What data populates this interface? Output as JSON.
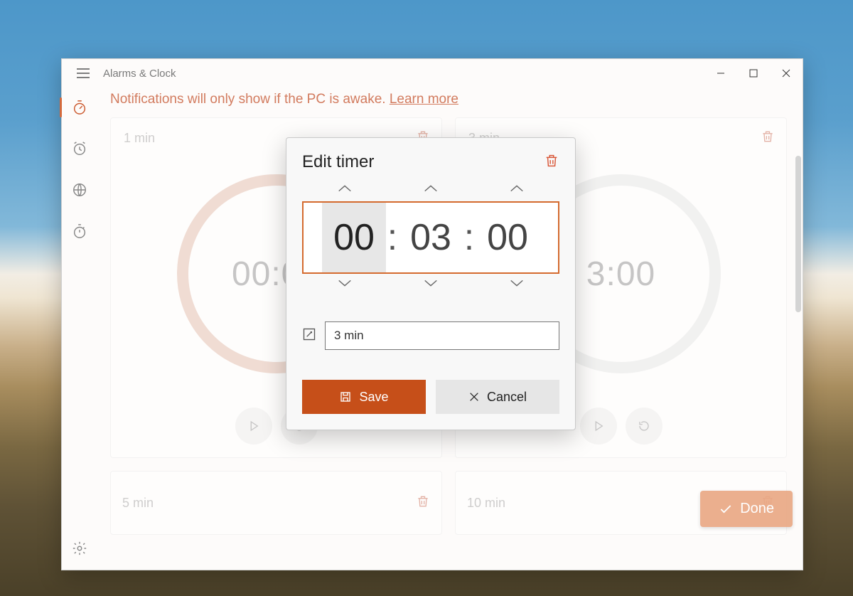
{
  "app": {
    "title": "Alarms & Clock"
  },
  "notice": {
    "text": "Notifications will only show if the PC is awake. ",
    "link_label": "Learn more"
  },
  "sidebar": {
    "items": [
      {
        "icon": "timer-icon",
        "active": true
      },
      {
        "icon": "alarm-icon",
        "active": false
      },
      {
        "icon": "world-clock-icon",
        "active": false
      },
      {
        "icon": "stopwatch-icon",
        "active": false
      }
    ],
    "settings_icon": "gear-icon"
  },
  "timers": [
    {
      "title": "1 min",
      "display": "00:00",
      "ring": "orange"
    },
    {
      "title": "3 min",
      "display": "3:00",
      "ring": "grey"
    },
    {
      "title": "5 min",
      "display": "",
      "ring": "none"
    },
    {
      "title": "10 min",
      "display": "",
      "ring": "none"
    }
  ],
  "done_button": {
    "label": "Done"
  },
  "modal": {
    "title": "Edit timer",
    "hours": "00",
    "minutes": "03",
    "seconds": "00",
    "name": "3 min",
    "save_label": "Save",
    "cancel_label": "Cancel"
  },
  "colors": {
    "accent": "#c64f19",
    "accent_light": "#e9a783"
  }
}
